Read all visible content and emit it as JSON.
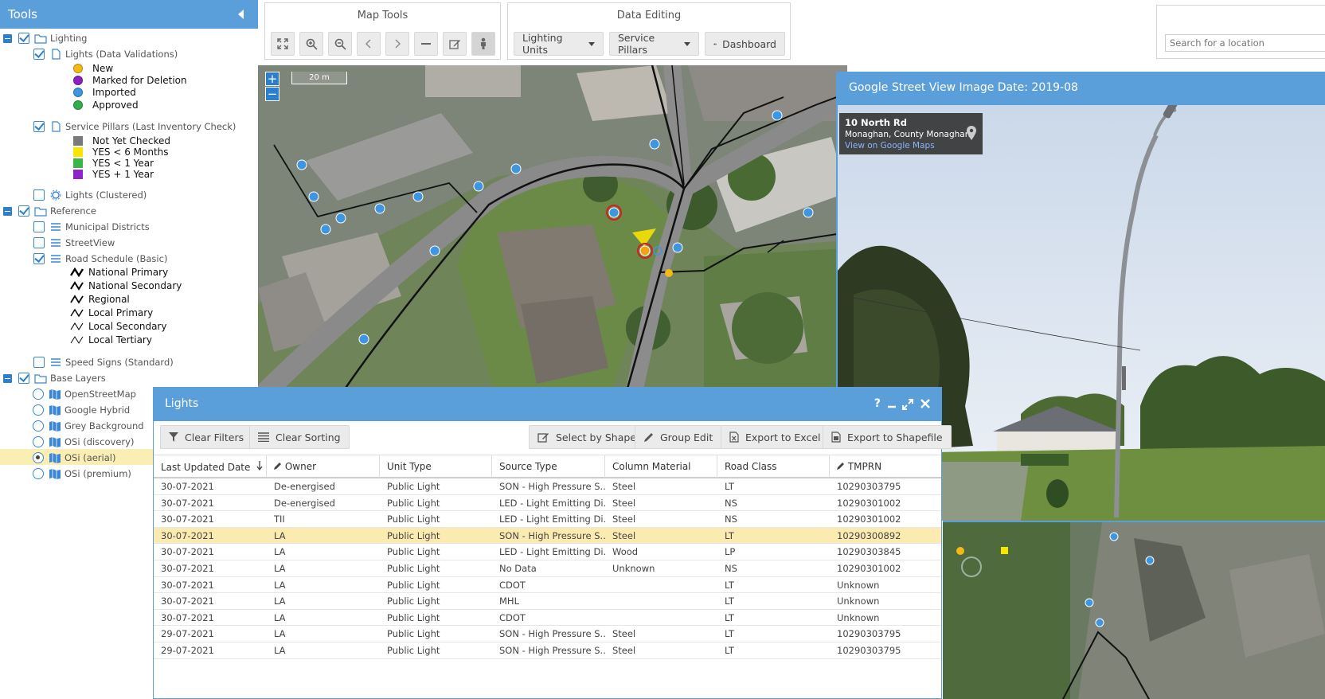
{
  "tools": {
    "title": "Tools",
    "lighting": "Lighting",
    "lights_validations": "Lights (Data Validations)",
    "legend_lights": [
      {
        "label": "New",
        "color": "#f4b915"
      },
      {
        "label": "Marked for Deletion",
        "color": "#8b1fc0"
      },
      {
        "label": "Imported",
        "color": "#3d96df"
      },
      {
        "label": "Approved",
        "color": "#2fae4d"
      }
    ],
    "service_pillars": "Service Pillars (Last Inventory Check)",
    "legend_pillars": [
      {
        "label": "Not Yet Checked",
        "color": "#7a7a7a"
      },
      {
        "label": "YES < 6 Months",
        "color": "#f6e600"
      },
      {
        "label": "YES < 1 Year",
        "color": "#39b54a"
      },
      {
        "label": "YES + 1 Year",
        "color": "#8f25c7"
      }
    ],
    "lights_clustered": "Lights (Clustered)",
    "reference": "Reference",
    "municipal_districts": "Municipal Districts",
    "streetview": "StreetView",
    "road_schedule": "Road Schedule (Basic)",
    "legend_roads": [
      "National Primary",
      "National Secondary",
      "Regional",
      "Local Primary",
      "Local Secondary",
      "Local Tertiary"
    ],
    "speed_signs": "Speed Signs (Standard)",
    "base_layers": "Base Layers",
    "base": [
      "OpenStreetMap",
      "Google Hybrid",
      "Grey Background",
      "OSi (discovery)",
      "OSi (aerial)",
      "OSi (premium)"
    ]
  },
  "map_tools": {
    "title": "Map Tools"
  },
  "data_editing": {
    "title": "Data Editing",
    "lighting_units": "Lighting Units",
    "service_pillars": "Service Pillars",
    "dashboard": "Dashboard"
  },
  "search": {
    "placeholder": "Search for a location"
  },
  "map": {
    "scale": "20 m",
    "zoom_in": "+",
    "zoom_out": "−"
  },
  "streetview": {
    "title": "Google Street View Image Date: 2019-08",
    "address": "10 North Rd",
    "locality": "Monaghan, County Monaghan",
    "link": "View on Google Maps"
  },
  "lights_dialog": {
    "title": "Lights",
    "help": "?",
    "clear_filters": "Clear Filters",
    "clear_sorting": "Clear Sorting",
    "select_by_shape": "Select by Shape",
    "group_edit": "Group Edit",
    "export_excel": "Export to Excel",
    "export_shapefile": "Export to Shapefile",
    "columns": [
      "Last Updated Date",
      "Owner",
      "Unit Type",
      "Source Type",
      "Column Material",
      "Road Class",
      "TMPRN"
    ],
    "rows": [
      [
        "30-07-2021",
        "De-energised",
        "Public Light",
        "SON - High Pressure S...",
        "Steel",
        "LT",
        "10290303795"
      ],
      [
        "30-07-2021",
        "De-energised",
        "Public Light",
        "LED - Light Emitting Di...",
        "Steel",
        "NS",
        "10290301002"
      ],
      [
        "30-07-2021",
        "TII",
        "Public Light",
        "LED - Light Emitting Di...",
        "Steel",
        "NS",
        "10290301002"
      ],
      [
        "30-07-2021",
        "LA",
        "Public Light",
        "SON - High Pressure S...",
        "Steel",
        "LT",
        "10290300892"
      ],
      [
        "30-07-2021",
        "LA",
        "Public Light",
        "LED - Light Emitting Di...",
        "Wood",
        "LP",
        "10290303845"
      ],
      [
        "30-07-2021",
        "LA",
        "Public Light",
        "No Data",
        "Unknown",
        "NS",
        "10290301002"
      ],
      [
        "30-07-2021",
        "LA",
        "Public Light",
        "CDOT",
        "",
        "LT",
        "Unknown"
      ],
      [
        "30-07-2021",
        "LA",
        "Public Light",
        "MHL",
        "",
        "LT",
        "Unknown"
      ],
      [
        "30-07-2021",
        "LA",
        "Public Light",
        "CDOT",
        "",
        "LT",
        "Unknown"
      ],
      [
        "29-07-2021",
        "LA",
        "Public Light",
        "SON - High Pressure S...",
        "Steel",
        "LT",
        "10290303795"
      ],
      [
        "29-07-2021",
        "LA",
        "Public Light",
        "SON - High Pressure S...",
        "Steel",
        "LT",
        "10290303795"
      ]
    ]
  }
}
